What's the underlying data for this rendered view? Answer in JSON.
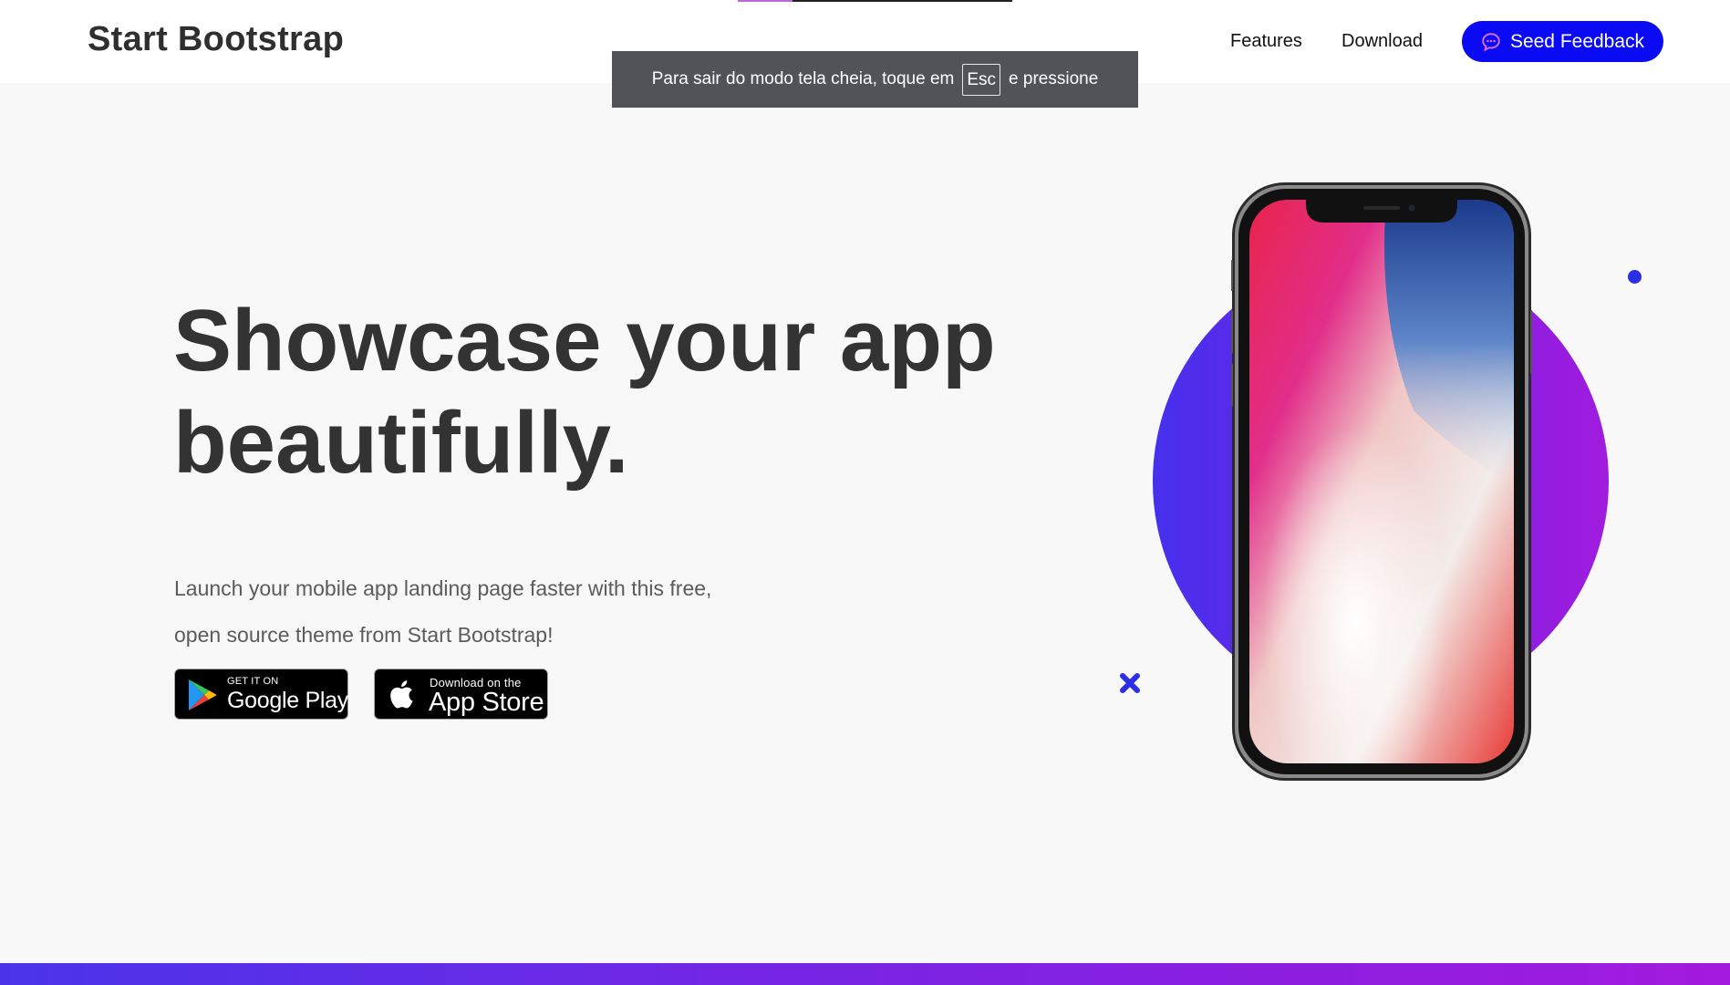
{
  "navbar": {
    "brand": "Start Bootstrap",
    "links": [
      "Features",
      "Download"
    ],
    "feedback_button": "Seed Feedback",
    "feedback_icon": "chat-bubble-icon"
  },
  "fullscreen_notice": {
    "text_before": "Para sair do modo tela cheia, toque em",
    "key": "Esc",
    "text_after": "e pressione"
  },
  "hero": {
    "title_line1": "Showcase your app",
    "title_line2": "beautifully.",
    "subtitle_line1": "Launch your mobile app landing page faster with this free,",
    "subtitle_line2": "open source theme from Start Bootstrap!",
    "google_play": {
      "small": "GET IT ON",
      "big": "Google Play",
      "icon": "google-play-icon"
    },
    "app_store": {
      "small": "Download on the",
      "big": "App Store",
      "icon": "apple-icon"
    }
  },
  "colors": {
    "accent_blue": "#0a0af5",
    "gradient_start": "#4630ec",
    "gradient_end": "#a01bde",
    "heading": "#333333"
  }
}
